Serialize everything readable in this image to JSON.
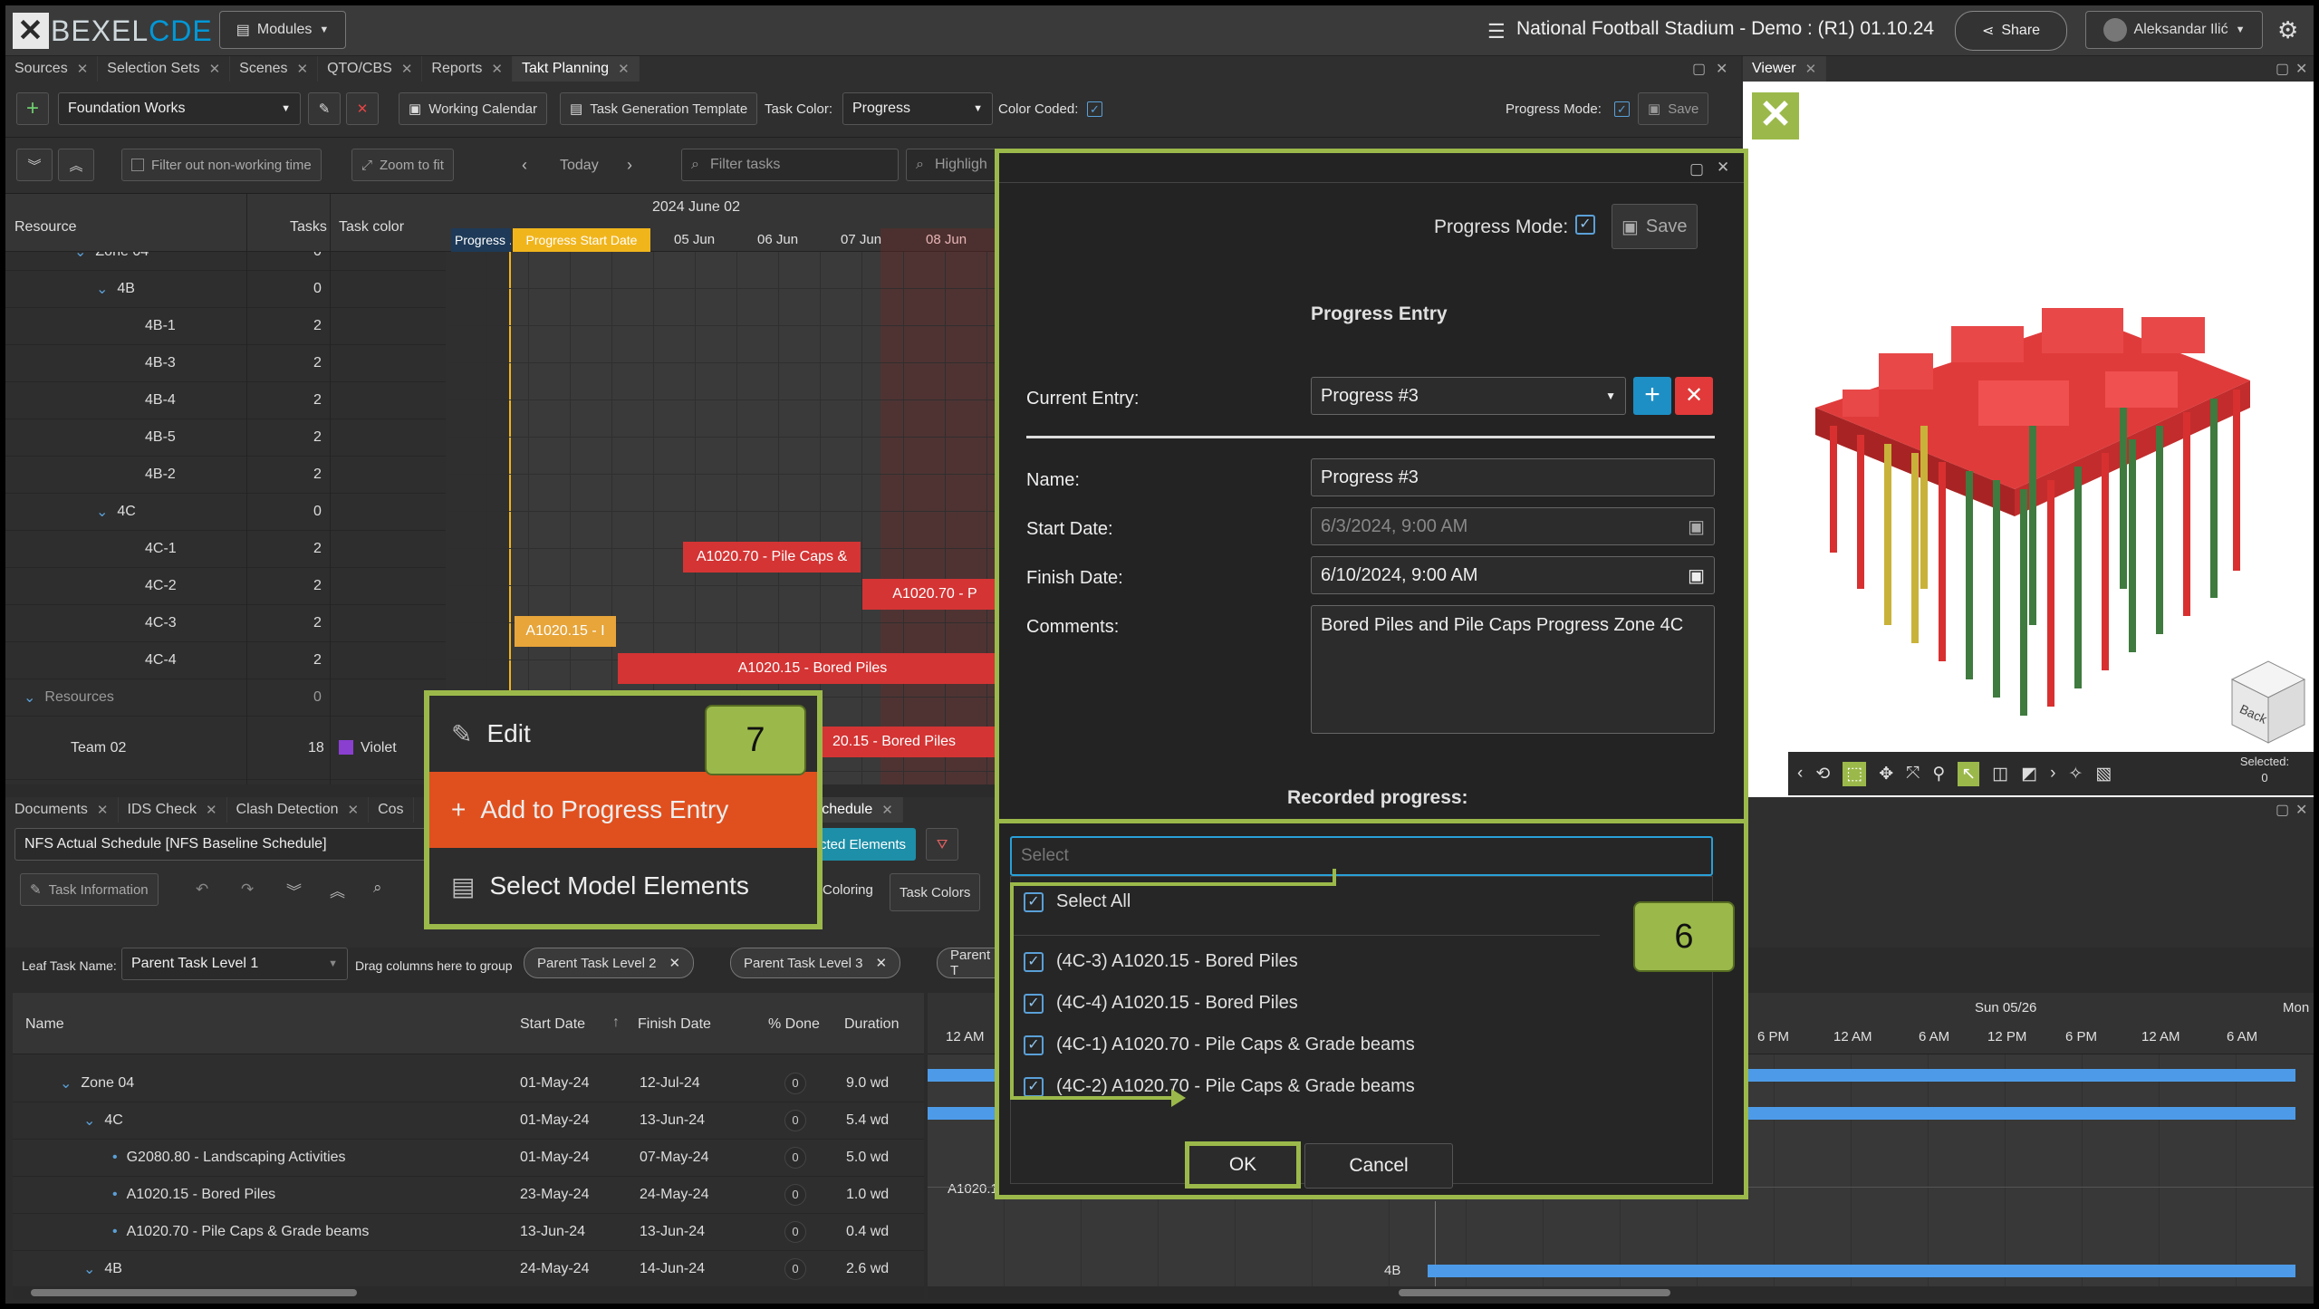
{
  "app": {
    "logo_a": "BEXEL",
    "logo_b": "CDE",
    "modules_label": "Modules",
    "project_title": "National Football Stadium - Demo : (R1) 01.10.24",
    "share_label": "Share",
    "user_name": "Aleksandar Ilić"
  },
  "top_tabs": [
    "Sources",
    "Selection Sets",
    "Scenes",
    "QTO/CBS",
    "Reports",
    "Takt Planning"
  ],
  "viewer_tab": "Viewer",
  "toolbar1": {
    "plan_select": "Foundation Works",
    "working_calendar": "Working Calendar",
    "task_gen_template": "Task Generation Template",
    "task_color_label": "Task Color:",
    "task_color_value": "Progress",
    "color_coded_label": "Color Coded:",
    "progress_mode_label": "Progress Mode:",
    "save_label": "Save"
  },
  "toolbar2": {
    "filter_nonworking": "Filter out non-working time",
    "zoom_to_fit": "Zoom to fit",
    "today": "Today",
    "filter_tasks_placeholder": "Filter tasks",
    "highlight": "Highligh"
  },
  "resource_grid": {
    "headers": {
      "resource": "Resource",
      "tasks": "Tasks",
      "task_color": "Task color"
    },
    "rows": [
      {
        "name": "Zone 04",
        "tasks": "0"
      },
      {
        "name": "4B",
        "tasks": "0"
      },
      {
        "name": "4B-1",
        "tasks": "2"
      },
      {
        "name": "4B-3",
        "tasks": "2"
      },
      {
        "name": "4B-4",
        "tasks": "2"
      },
      {
        "name": "4B-5",
        "tasks": "2"
      },
      {
        "name": "4B-2",
        "tasks": "2"
      },
      {
        "name": "4C",
        "tasks": "0"
      },
      {
        "name": "4C-1",
        "tasks": "2"
      },
      {
        "name": "4C-2",
        "tasks": "2"
      },
      {
        "name": "4C-3",
        "tasks": "2"
      },
      {
        "name": "4C-4",
        "tasks": "2"
      },
      {
        "name": "Resources",
        "tasks": "0"
      },
      {
        "name": "Team 02",
        "tasks": "18",
        "color": "Violet"
      }
    ]
  },
  "gantt": {
    "month": "2024 June 02",
    "days": [
      "05 Jun",
      "06 Jun",
      "07 Jun",
      "08 Jun"
    ],
    "progress_head": "Progress ...",
    "progress_start": "Progress Start Date",
    "bars": {
      "b1": "A1020.70 - Pile Caps &",
      "b2": "A1020.70 - P",
      "b3": "A1020.15 - I",
      "b4": "A1020.15 - Bored Piles",
      "b5": "20.15 - Bored Piles"
    }
  },
  "context_menu": {
    "edit": "Edit",
    "add": "Add to Progress Entry",
    "select": "Select Model Elements",
    "badge": "7"
  },
  "progress_dialog": {
    "progress_mode_label": "Progress Mode:",
    "save_label": "Save",
    "title": "Progress Entry",
    "current_entry_label": "Current Entry:",
    "current_entry_value": "Progress #3",
    "name_label": "Name:",
    "name_value": "Progress #3",
    "start_label": "Start Date:",
    "start_value": "6/3/2024, 9:00 AM",
    "finish_label": "Finish Date:",
    "finish_value": "6/10/2024, 9:00 AM",
    "comments_label": "Comments:",
    "comments_value": "Bored Piles and Pile Caps Progress Zone 4C",
    "recorded_label": "Recorded progress:"
  },
  "select_popup": {
    "placeholder": "Select",
    "select_all": "Select All",
    "items": [
      "(4C-3) A1020.15 - Bored Piles",
      "(4C-4) A1020.15 - Bored Piles",
      "(4C-1) A1020.70 - Pile Caps & Grade beams",
      "(4C-2) A1020.70 - Pile Caps & Grade beams"
    ],
    "ok": "OK",
    "cancel": "Cancel",
    "badge": "6"
  },
  "bottom_tabs": [
    "Documents",
    "IDS Check",
    "Clash Detection",
    "Cos",
    "Schedule"
  ],
  "schedule": {
    "schedule_select": "NFS Actual Schedule [NFS Baseline Schedule]",
    "task_information": "Task Information",
    "selected_elements": "cted Elements",
    "coloring": "Coloring",
    "task_colors": "Task Colors",
    "leaf_label": "Leaf Task Name:",
    "leaf_value": "Parent Task Level 1",
    "drag_hint": "Drag columns here to group",
    "chips": [
      "Parent Task Level 2",
      "Parent Task Level 3",
      "Parent T"
    ],
    "headers": {
      "name": "Name",
      "start": "Start Date",
      "finish": "Finish Date",
      "done": "% Done",
      "duration": "Duration"
    },
    "rows": [
      {
        "name": "Zone 04",
        "start": "01-May-24",
        "finish": "12-Jul-24",
        "done": "0",
        "duration": "9.0 wd"
      },
      {
        "name": "4C",
        "start": "01-May-24",
        "finish": "13-Jun-24",
        "done": "0",
        "duration": "5.4 wd"
      },
      {
        "name": "G2080.80 - Landscaping Activities",
        "start": "01-May-24",
        "finish": "07-May-24",
        "done": "0",
        "duration": "5.0 wd"
      },
      {
        "name": "A1020.15 - Bored Piles",
        "start": "23-May-24",
        "finish": "24-May-24",
        "done": "0",
        "duration": "1.0 wd"
      },
      {
        "name": "A1020.70 - Pile Caps & Grade beams",
        "start": "13-Jun-24",
        "finish": "13-Jun-24",
        "done": "0",
        "duration": "0.4 wd"
      },
      {
        "name": "4B",
        "start": "24-May-24",
        "finish": "14-Jun-24",
        "done": "0",
        "duration": "2.6 wd"
      }
    ],
    "timeline_day": "Sun 05/26",
    "timeline_mon": "Mon",
    "hours": [
      "12 AM",
      "6 PM",
      "12 AM",
      "6 AM",
      "12 PM",
      "6 PM",
      "12 AM",
      "6 AM"
    ],
    "bar_label_a": "A1020.1",
    "bar_label_4b": "4B"
  },
  "viewer": {
    "selected_label": "Selected:",
    "selected_count": "0",
    "cube_label": "Back"
  }
}
